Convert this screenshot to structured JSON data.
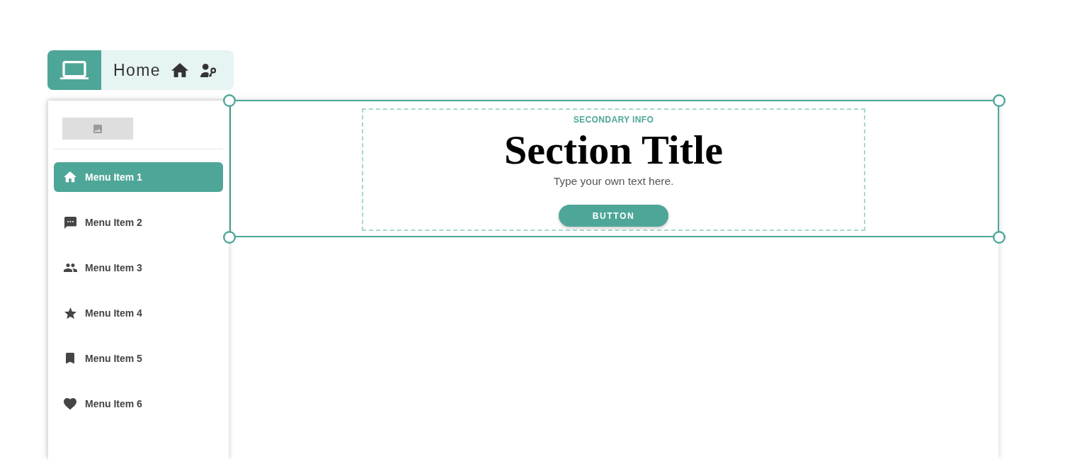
{
  "header": {
    "title": "Home"
  },
  "sidebar": {
    "items": [
      {
        "label": "Menu Item 1",
        "selected": true
      },
      {
        "label": "Menu Item 2",
        "selected": false
      },
      {
        "label": "Menu Item 3",
        "selected": false
      },
      {
        "label": "Menu Item 4",
        "selected": false
      },
      {
        "label": "Menu Item 5",
        "selected": false
      },
      {
        "label": "Menu Item 6",
        "selected": false
      }
    ]
  },
  "section": {
    "selected": true,
    "eyebrow": "SECONDARY INFO",
    "title": "Section Title",
    "text": "Type your own text here.",
    "button": "BUTTON"
  }
}
